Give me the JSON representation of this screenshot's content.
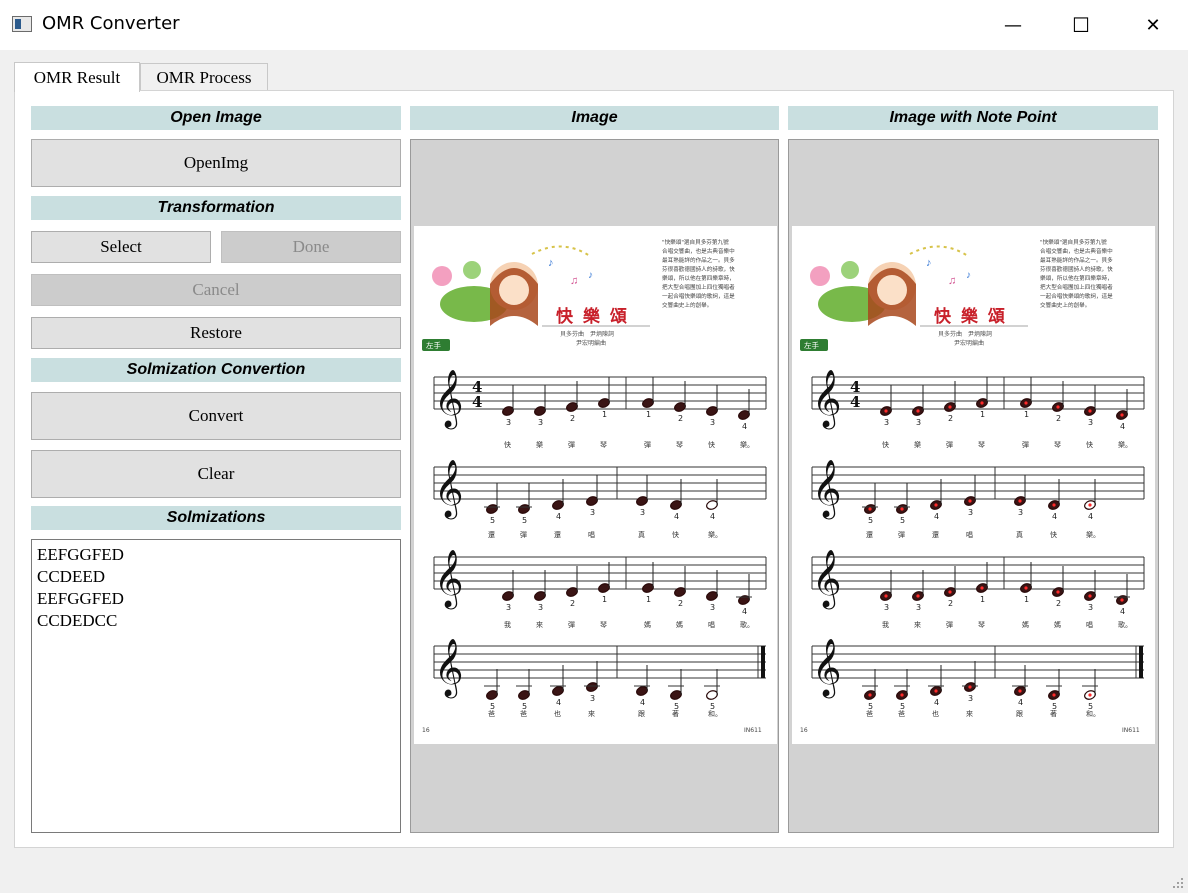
{
  "window": {
    "title": "OMR Converter",
    "minimize": "—",
    "maximize": "☐",
    "close": "✕"
  },
  "tabs": [
    {
      "label": "OMR Result"
    },
    {
      "label": "OMR Process"
    }
  ],
  "left": {
    "open_header": "Open Image",
    "open_button": "OpenImg",
    "transformation_header": "Transformation",
    "select_button": "Select",
    "done_button": "Done",
    "cancel_button": "Cancel",
    "restore_button": "Restore",
    "solmization_header": "Solmization Convertion",
    "convert_button": "Convert",
    "clear_button": "Clear",
    "solmizations_header": "Solmizations",
    "solmizations": [
      "EEFGGFED",
      "CCDEED",
      "EEFGGFED",
      "CCDEDCC"
    ]
  },
  "image_panel": {
    "header": "Image"
  },
  "note_panel": {
    "header": "Image with Note Point"
  },
  "sheet": {
    "title": "快 樂 頌",
    "left_hand_tag": "左手",
    "credits": [
      "貝多芬曲　尹炳陳詞",
      "尹宏明編曲"
    ],
    "page_number": "16",
    "code": "IN611",
    "intro": [
      "\"快樂頌\"選自貝多芬第九號",
      "合唱交響曲，也是古典音樂中",
      "最耳熟能詳的作品之一。貝多",
      "芬很喜歡德國詩人的詩歌，快",
      "樂頌，所以他在第四樂章時，",
      "把大型合唱團加上四位獨唱者",
      "一起合唱快樂頌的歌詞，這是",
      "交響曲史上的創舉。"
    ],
    "rows": [
      {
        "fingers": [
          "3",
          "3",
          "2",
          "1",
          "1",
          "2",
          "3",
          "4"
        ],
        "lyrics": [
          "快",
          "樂",
          "彈",
          "琴",
          "彈",
          "琴",
          "快",
          "樂。"
        ]
      },
      {
        "fingers": [
          "5",
          "5",
          "4",
          "3",
          "3",
          "4",
          "4"
        ],
        "lyrics": [
          "還",
          "彈",
          "還",
          "唱",
          "真",
          "快",
          "樂。"
        ]
      },
      {
        "fingers": [
          "3",
          "3",
          "2",
          "1",
          "1",
          "2",
          "3",
          "4"
        ],
        "lyrics": [
          "我",
          "來",
          "彈",
          "琴",
          "媽",
          "媽",
          "唱",
          "歌。"
        ]
      },
      {
        "fingers": [
          "5",
          "5",
          "4",
          "3",
          "4",
          "5",
          "5"
        ],
        "lyrics": [
          "爸",
          "爸",
          "也",
          "來",
          "跟",
          "著",
          "和。"
        ]
      }
    ]
  },
  "colors": {
    "header_bg": "#c9dfe0",
    "accent_red": "#c8202a",
    "tag_green": "#2e7d32"
  }
}
